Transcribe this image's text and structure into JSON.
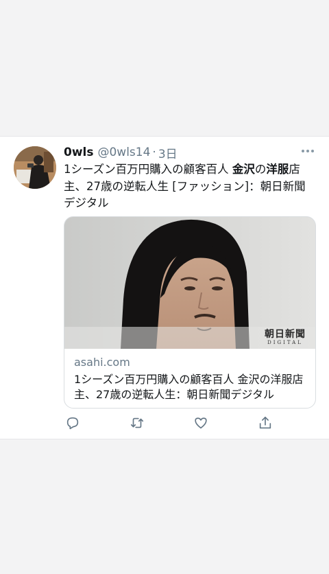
{
  "tweet": {
    "author_name": "0wls",
    "handle": "@0wls14",
    "separator": "·",
    "time": "3日",
    "more_icon": "more-horizontal-icon",
    "text_part1": "1シーズン百万円購入の顧客百人 ",
    "text_bold1": "金沢",
    "text_part2": "の",
    "text_bold2": "洋服",
    "text_part3": "店主、27歳の逆転人生 [ファッション]：朝日新聞デジタル"
  },
  "card": {
    "logo_main": "朝日新聞",
    "logo_sub": "DIGITAL",
    "domain": "asahi.com",
    "title": "1シーズン百万円購入の顧客百人 金沢の洋服店主、27歳の逆転人生：朝日新聞デジタル"
  },
  "actions": {
    "reply_icon": "reply-icon",
    "retweet_icon": "retweet-icon",
    "like_icon": "heart-icon",
    "share_icon": "share-icon",
    "icon_color": "#657786"
  }
}
